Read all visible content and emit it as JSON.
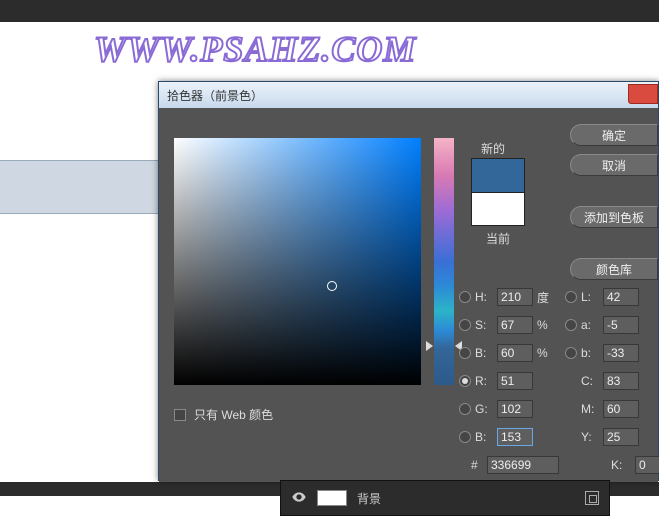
{
  "watermark": "WWW.PSAHZ.COM",
  "dialog": {
    "title": "拾色器（前景色）"
  },
  "buttons": {
    "ok": "确定",
    "cancel": "取消",
    "add_swatch": "添加到色板",
    "color_lib": "颜色库"
  },
  "preview": {
    "new_label": "新的",
    "current_label": "当前",
    "new_color": "#336699",
    "current_color": "#ffffff"
  },
  "fields": {
    "H": {
      "label": "H:",
      "value": "210",
      "unit": "度"
    },
    "S": {
      "label": "S:",
      "value": "67",
      "unit": "%"
    },
    "Bv": {
      "label": "B:",
      "value": "60",
      "unit": "%"
    },
    "R": {
      "label": "R:",
      "value": "51"
    },
    "G": {
      "label": "G:",
      "value": "102"
    },
    "B": {
      "label": "B:",
      "value": "153"
    },
    "L": {
      "label": "L:",
      "value": "42"
    },
    "a": {
      "label": "a:",
      "value": "-5"
    },
    "b": {
      "label": "b:",
      "value": "-33"
    },
    "C": {
      "label": "C:",
      "value": "83"
    },
    "M": {
      "label": "M:",
      "value": "60"
    },
    "Y": {
      "label": "Y:",
      "value": "25"
    },
    "K": {
      "label": "K:",
      "value": "0"
    },
    "hex": {
      "label": "#",
      "value": "336699"
    }
  },
  "selected_radio": "R",
  "web_only": "只有 Web 颜色",
  "layer": {
    "label": "背景"
  }
}
